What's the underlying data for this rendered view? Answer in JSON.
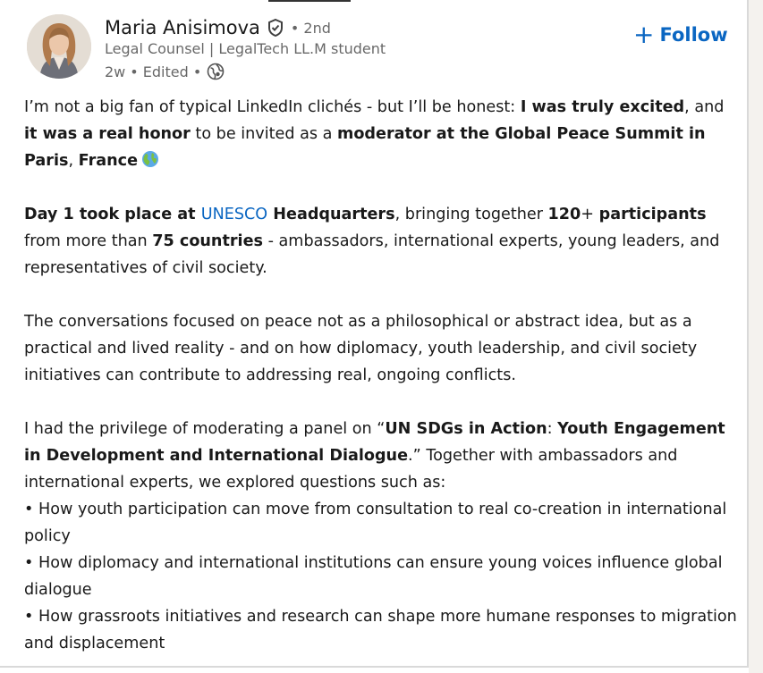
{
  "author": {
    "name": "Maria Anisimova",
    "degree": "• 2nd",
    "headline": "Legal Counsel | LegalTech LL.M student",
    "time": "2w",
    "edited": "• Edited •",
    "verified_icon": "verified-shield-icon",
    "visibility_icon": "globe-icon"
  },
  "follow_button": {
    "icon": "+",
    "label": "Follow"
  },
  "post": {
    "p1": {
      "t1": "I’m not a big fan of typical LinkedIn clichés - but I’ll be honest: ",
      "b1": "I was truly excited",
      "t2": ", and ",
      "b2": "it was a real honor",
      "t3": " to be invited as a ",
      "b3": "moderator at the Global Peace Summit in Paris",
      "t4": ", ",
      "b4": "France",
      "emoji_icon": "globe-earth-emoji"
    },
    "p2": {
      "b1": "Day 1 took place at ",
      "link": "UNESCO",
      "b2": " Headquarters",
      "t1": ", bringing together ",
      "b3": "120",
      "t2": "+ ",
      "b4": "participants",
      "t3": " from more than ",
      "b5": "75 countries",
      "t4": " - ambassadors, international experts, young leaders, and representatives of civil society."
    },
    "p3": "The conversations focused on peace not as a philosophical or abstract idea, but as a practical and lived reality - and on how diplomacy, youth leadership, and civil society initiatives can contribute to addressing real, ongoing conflicts.",
    "p4": {
      "t1": "I had the privilege of moderating a panel on “",
      "b1": "UN SDGs in Action",
      "t2": ": ",
      "b2": "Youth Engagement in Development and International Dialogue",
      "t3": ".” Together with ambassadors and international experts, we explored questions such as:",
      "bullets": [
        "• How youth participation can move from consultation to real co-creation in international policy",
        "• How diplomacy and international institutions can ensure young voices influence global dialogue",
        "• How grassroots initiatives and research can shape more humane responses to migration and displacement"
      ]
    }
  },
  "colors": {
    "accent": "#0a66c2",
    "secondary_text": "#666666",
    "border": "#d9d9d9"
  }
}
